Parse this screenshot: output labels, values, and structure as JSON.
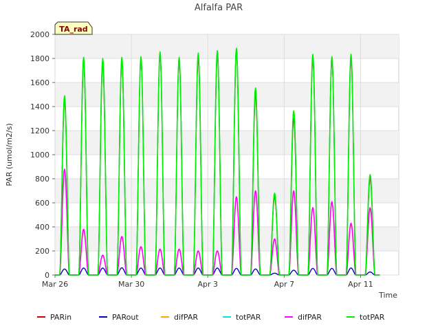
{
  "chart_data": {
    "type": "line",
    "title": "Alfalfa PAR",
    "xlabel": "Time",
    "ylabel": "PAR (umol/m2/s)",
    "ylim": [
      0,
      2000
    ],
    "yticks": [
      0,
      200,
      400,
      600,
      800,
      1000,
      1200,
      1400,
      1600,
      1800,
      2000
    ],
    "xlim": [
      "2024-03-26",
      "2024-04-13"
    ],
    "xticks": [
      {
        "date": "2024-03-26",
        "label": "Mar 26"
      },
      {
        "date": "2024-03-30",
        "label": "Mar 30"
      },
      {
        "date": "2024-04-03",
        "label": "Apr 3"
      },
      {
        "date": "2024-04-07",
        "label": "Apr 7"
      },
      {
        "date": "2024-04-11",
        "label": "Apr 11"
      }
    ],
    "grid": true,
    "legend_position": "bottom",
    "badge": "TA_rad",
    "days": [
      "2024-03-26",
      "2024-03-27",
      "2024-03-28",
      "2024-03-29",
      "2024-03-30",
      "2024-03-31",
      "2024-04-01",
      "2024-04-02",
      "2024-04-03",
      "2024-04-04",
      "2024-04-05",
      "2024-04-06",
      "2024-04-07",
      "2024-04-08",
      "2024-04-09",
      "2024-04-10",
      "2024-04-11",
      "2024-04-12"
    ],
    "series": [
      {
        "name": "PARin",
        "color": "#cc0000",
        "daily_peak": [
          1450,
          1780,
          1760,
          1770,
          1800,
          1830,
          1780,
          1800,
          1830,
          1860,
          1500,
          650,
          1300,
          1800,
          1780,
          1800,
          800
        ]
      },
      {
        "name": "PARout",
        "color": "#0000cc",
        "daily_peak": [
          50,
          58,
          58,
          60,
          58,
          58,
          58,
          58,
          58,
          55,
          50,
          15,
          40,
          55,
          55,
          58,
          25
        ]
      },
      {
        "name": "difPAR",
        "color": "#ffa500",
        "daily_peak": [
          880,
          370,
          165,
          320,
          235,
          210,
          215,
          200,
          200,
          650,
          700,
          300,
          700,
          560,
          600,
          420,
          550
        ]
      },
      {
        "name": "totPAR",
        "color": "#00e5e5",
        "daily_peak": [
          1480,
          1800,
          1790,
          1800,
          1810,
          1850,
          1800,
          1840,
          1860,
          1880,
          1550,
          680,
          1360,
          1830,
          1810,
          1830,
          830
        ]
      },
      {
        "name": "difPAR",
        "color": "#ff00ff",
        "daily_peak": [
          880,
          380,
          165,
          320,
          235,
          215,
          215,
          200,
          200,
          650,
          700,
          300,
          700,
          560,
          610,
          430,
          560
        ]
      },
      {
        "name": "totPAR",
        "color": "#00ee00",
        "daily_peak": [
          1490,
          1810,
          1800,
          1810,
          1815,
          1855,
          1810,
          1845,
          1865,
          1885,
          1555,
          680,
          1365,
          1835,
          1815,
          1835,
          835
        ]
      }
    ]
  }
}
